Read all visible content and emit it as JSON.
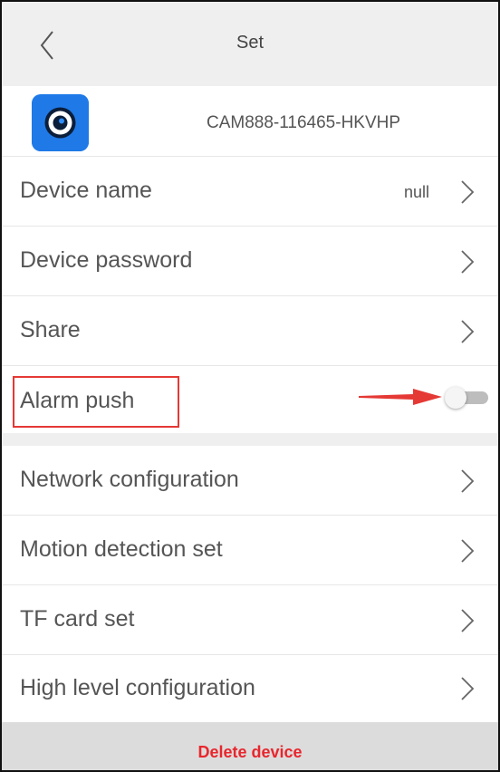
{
  "header": {
    "title": "Set",
    "back_icon": "chevron-left-icon"
  },
  "device": {
    "id": "CAM888-116465-HKVHP",
    "icon": "camera-eye-app-icon",
    "icon_color": "#1f7ae8"
  },
  "settings_group_1": [
    {
      "label": "Device name",
      "value": "null"
    },
    {
      "label": "Device password"
    },
    {
      "label": "Share"
    }
  ],
  "alarm": {
    "label": "Alarm push",
    "enabled": false,
    "highlight_color": "#e53935"
  },
  "settings_group_2": [
    {
      "label": "Network configuration"
    },
    {
      "label": "Motion detection set"
    },
    {
      "label": "TF card set"
    },
    {
      "label": "High level configuration"
    }
  ],
  "footer": {
    "delete_label": "Delete device",
    "delete_color": "#e8262d"
  }
}
